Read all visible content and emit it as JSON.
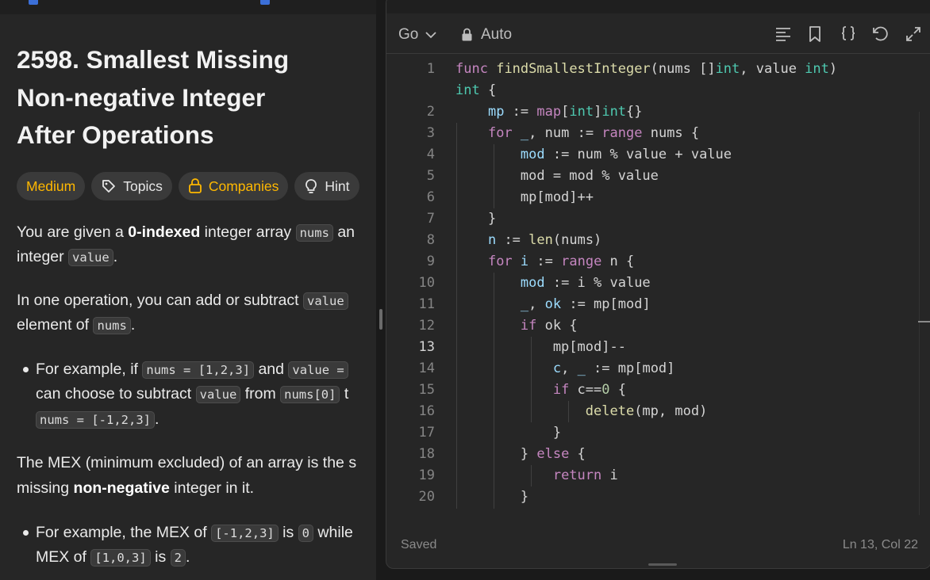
{
  "problem": {
    "title_lines": [
      "2598. Smallest Missing",
      "Non-negative Integer",
      "After Operations"
    ],
    "tags": {
      "difficulty": "Medium",
      "topics": "Topics",
      "companies": "Companies",
      "hint": "Hint"
    },
    "p1": {
      "a": "You are given a ",
      "b": "0-indexed",
      "c": " integer array ",
      "code1": "nums",
      "d": " an",
      "e": "integer ",
      "code2": "value",
      "f": "."
    },
    "p2": {
      "a": "In one operation, you can add or subtract ",
      "code1": "value",
      "b": "element of ",
      "code2": "nums",
      "c": "."
    },
    "b1": {
      "a": "For example, if ",
      "code1": "nums = [1,2,3]",
      "b": " and ",
      "code2": "value =",
      "c": "can choose to subtract ",
      "code3": "value",
      "d": " from ",
      "code4": "nums[0]",
      "e": " t",
      "code5": "nums = [-1,2,3]",
      "f": "."
    },
    "p3": {
      "a": "The MEX (minimum excluded) of an array is the s",
      "b": "missing ",
      "c": "non-negative",
      "d": " integer in it."
    },
    "b2": {
      "a": "For example, the MEX of ",
      "code1": "[-1,2,3]",
      "b": " is ",
      "code2": "0",
      "c": " while",
      "d": "MEX of ",
      "code3": "[1,0,3]",
      "e": " is ",
      "code4": "2",
      "f": "."
    }
  },
  "editor": {
    "language": "Go",
    "mode": "Auto",
    "status_saved": "Saved",
    "cursor_position": "Ln 13, Col 22",
    "active_line": "13",
    "line_numbers": [
      "1",
      "",
      "2",
      "3",
      "4",
      "5",
      "6",
      "7",
      "8",
      "9",
      "10",
      "11",
      "12",
      "13",
      "14",
      "15",
      "16",
      "17",
      "18",
      "19",
      "20"
    ],
    "code_lines": [
      "func findSmallestInteger(nums []int, value int)",
      "int {",
      "    mp := map[int]int{}",
      "    for _, num := range nums {",
      "        mod := num % value + value",
      "        mod = mod % value",
      "        mp[mod]++",
      "    }",
      "    n := len(nums)",
      "    for i := range n {",
      "        mod := i % value",
      "        _, ok := mp[mod]",
      "        if ok {",
      "            mp[mod]--",
      "            c, _ := mp[mod]",
      "            if c==0 {",
      "                delete(mp, mod)",
      "            }",
      "        } else {",
      "            return i",
      "        }"
    ]
  },
  "colors": {
    "keyword": "#c586c0",
    "function": "#dcdcaa",
    "type": "#4ec9b0",
    "variable": "#9cdcfe",
    "number": "#b5cea8",
    "difficulty_medium": "#ffb800"
  }
}
